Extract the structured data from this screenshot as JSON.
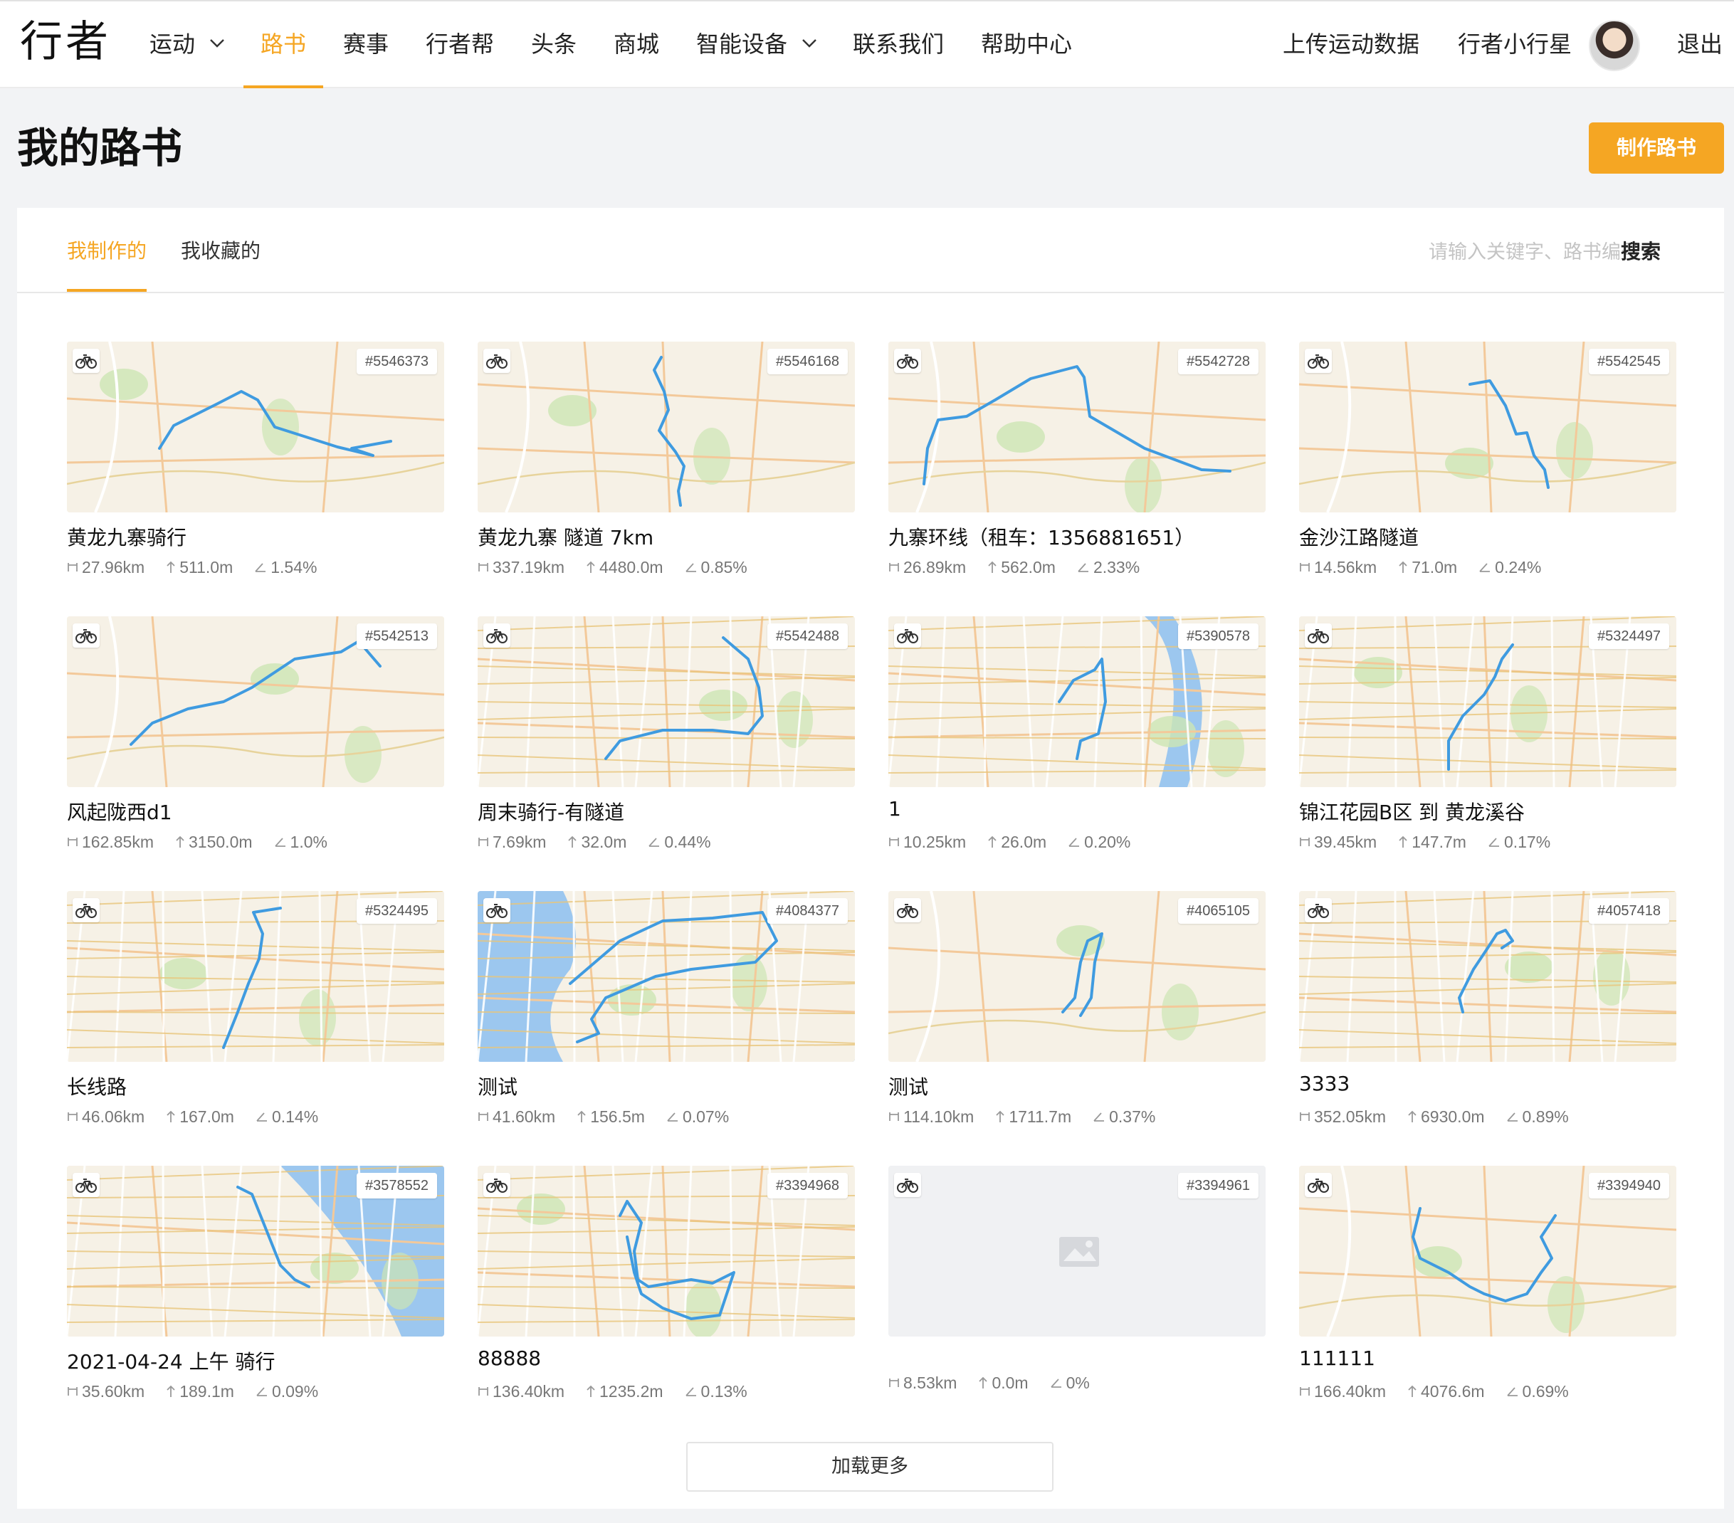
{
  "brand": {
    "logo": "行者"
  },
  "nav": {
    "items": [
      {
        "label": "运动",
        "dropdown": true
      },
      {
        "label": "路书",
        "active": true
      },
      {
        "label": "赛事"
      },
      {
        "label": "行者帮"
      },
      {
        "label": "头条"
      },
      {
        "label": "商城"
      },
      {
        "label": "智能设备",
        "dropdown": true
      },
      {
        "label": "联系我们"
      },
      {
        "label": "帮助中心"
      }
    ],
    "upload": "上传运动数据",
    "username": "行者小行星",
    "logout": "退出"
  },
  "header": {
    "title": "我的路书",
    "create_button": "制作路书"
  },
  "tabs": [
    {
      "label": "我制作的",
      "active": true
    },
    {
      "label": "我收藏的"
    }
  ],
  "search": {
    "placeholder": "请输入关键字、路书编号",
    "button": "搜索"
  },
  "colors": {
    "accent": "#f5a623",
    "route": "#3f9be0",
    "map_bg": "#f6f1e6"
  },
  "routes": [
    {
      "id": "#5546373",
      "title": "黄龙九寨骑行",
      "distance": "27.96km",
      "ascent": "511.0m",
      "grade": "1.54%"
    },
    {
      "id": "#5546168",
      "title": "黄龙九寨 隧道 7km",
      "distance": "337.19km",
      "ascent": "4480.0m",
      "grade": "0.85%"
    },
    {
      "id": "#5542728",
      "title": "九寨环线（租车：1356881651）",
      "distance": "26.89km",
      "ascent": "562.0m",
      "grade": "2.33%"
    },
    {
      "id": "#5542545",
      "title": "金沙江路隧道",
      "distance": "14.56km",
      "ascent": "71.0m",
      "grade": "0.24%"
    },
    {
      "id": "#5542513",
      "title": "风起陇西d1",
      "distance": "162.85km",
      "ascent": "3150.0m",
      "grade": "1.0%"
    },
    {
      "id": "#5542488",
      "title": "周末骑行-有隧道",
      "distance": "7.69km",
      "ascent": "32.0m",
      "grade": "0.44%"
    },
    {
      "id": "#5390578",
      "title": "1",
      "distance": "10.25km",
      "ascent": "26.0m",
      "grade": "0.20%"
    },
    {
      "id": "#5324497",
      "title": "锦江花园B区 到 黄龙溪谷",
      "distance": "39.45km",
      "ascent": "147.7m",
      "grade": "0.17%"
    },
    {
      "id": "#5324495",
      "title": "长线路",
      "distance": "46.06km",
      "ascent": "167.0m",
      "grade": "0.14%"
    },
    {
      "id": "#4084377",
      "title": "测试",
      "distance": "41.60km",
      "ascent": "156.5m",
      "grade": "0.07%"
    },
    {
      "id": "#4065105",
      "title": "测试",
      "distance": "114.10km",
      "ascent": "1711.7m",
      "grade": "0.37%"
    },
    {
      "id": "#4057418",
      "title": "3333",
      "distance": "352.05km",
      "ascent": "6930.0m",
      "grade": "0.89%"
    },
    {
      "id": "#3578552",
      "title": "2021-04-24 上午 骑行",
      "distance": "35.60km",
      "ascent": "189.1m",
      "grade": "0.09%"
    },
    {
      "id": "#3394968",
      "title": "88888",
      "distance": "136.40km",
      "ascent": "1235.2m",
      "grade": "0.13%"
    },
    {
      "id": "#3394961",
      "title": "",
      "distance": "8.53km",
      "ascent": "0.0m",
      "grade": "0%",
      "no_map": true
    },
    {
      "id": "#3394940",
      "title": "111111",
      "distance": "166.40km",
      "ascent": "4076.6m",
      "grade": "0.69%"
    }
  ],
  "load_more": "加载更多"
}
